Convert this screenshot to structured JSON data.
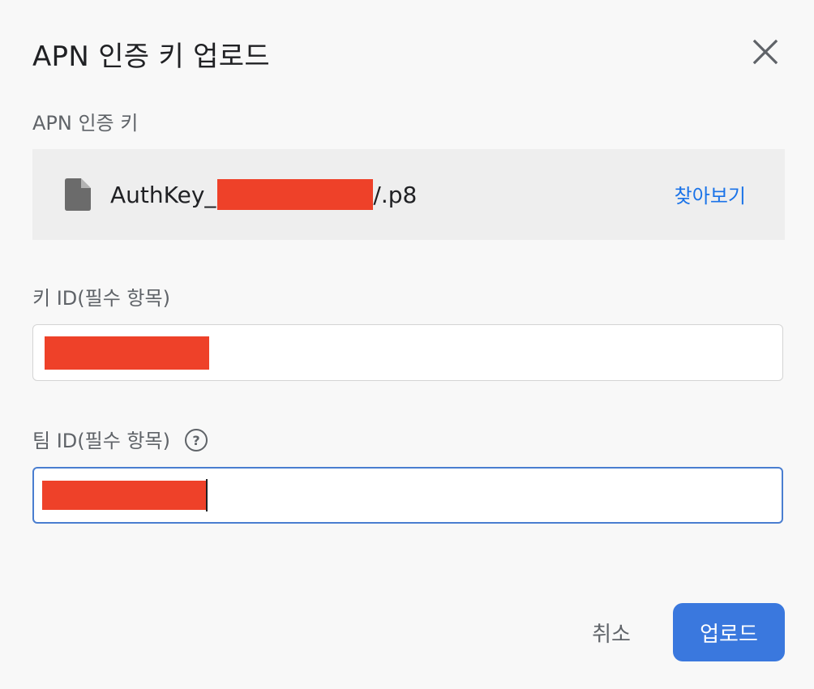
{
  "dialog": {
    "title": "APN 인증 키 업로드"
  },
  "apn_key": {
    "label": "APN 인증 키",
    "file_name_prefix": "AuthKey_",
    "file_name_suffix": "/.p8",
    "browse_label": "찾아보기"
  },
  "key_id": {
    "label": "키 ID(필수 항목)",
    "value": ""
  },
  "team_id": {
    "label": "팀 ID(필수 항목)",
    "help_glyph": "?",
    "value": ""
  },
  "actions": {
    "cancel_label": "취소",
    "upload_label": "업로드"
  },
  "colors": {
    "accent": "#1a73e8",
    "primary_button": "#3a78de",
    "redaction": "#ee4129",
    "focused_border": "#4a7ed0"
  },
  "icons": {
    "close": "close-icon",
    "file": "file-icon",
    "help": "help-icon"
  }
}
